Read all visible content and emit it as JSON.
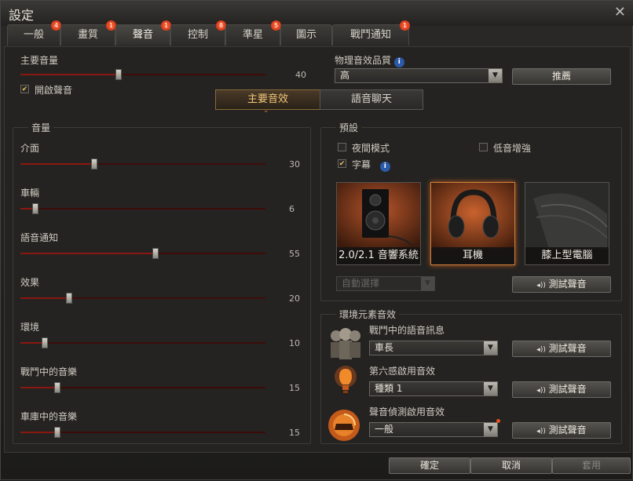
{
  "window": {
    "title": "設定",
    "close_glyph": "✕"
  },
  "tabs": [
    {
      "label": "一般",
      "badge": "4"
    },
    {
      "label": "畫質",
      "badge": "1"
    },
    {
      "label": "聲音",
      "badge": "1"
    },
    {
      "label": "控制",
      "badge": "8"
    },
    {
      "label": "準星",
      "badge": "5"
    },
    {
      "label": "圖示",
      "badge": ""
    },
    {
      "label": "戰鬥通知",
      "badge": "1"
    }
  ],
  "master": {
    "label": "主要音量",
    "value": "40",
    "level": 40,
    "enable_label": "開啟聲音",
    "enabled": true
  },
  "physics": {
    "label": "物理音效品質",
    "info_glyph": "i",
    "selected": "高",
    "recommend_label": "推薦"
  },
  "subtabs": [
    {
      "label": "主要音效"
    },
    {
      "label": "語音聊天"
    }
  ],
  "volume": {
    "group_title": "音量",
    "sliders": [
      {
        "label": "介面",
        "value": "30",
        "level": 30
      },
      {
        "label": "車輛",
        "value": "6",
        "level": 6
      },
      {
        "label": "語音通知",
        "value": "55",
        "level": 55
      },
      {
        "label": "效果",
        "value": "20",
        "level": 20
      },
      {
        "label": "環境",
        "value": "10",
        "level": 10
      },
      {
        "label": "戰鬥中的音樂",
        "value": "15",
        "level": 15
      },
      {
        "label": "車庫中的音樂",
        "value": "15",
        "level": 15
      }
    ]
  },
  "presets": {
    "group_title": "預設",
    "night_mode_label": "夜間模式",
    "night_mode": false,
    "bass_label": "低音增強",
    "bass": false,
    "subtitles_label": "字幕",
    "subtitles": true,
    "info_glyph": "i",
    "cards": [
      {
        "label": "2.0/2.1 音響系統",
        "icon": "speaker-icon",
        "selected": false
      },
      {
        "label": "耳機",
        "icon": "headphones-icon",
        "selected": true
      },
      {
        "label": "膝上型電腦",
        "icon": "laptop-icon",
        "selected": false
      }
    ],
    "auto_select": "自動選擇",
    "test_label": "測試聲音",
    "test_glyph": "◂))"
  },
  "env": {
    "group_title": "環境元素音效",
    "items": [
      {
        "label": "戰鬥中的語音訊息",
        "selected": "車長",
        "icon": "crew-icon"
      },
      {
        "label": "第六感啟用音效",
        "selected": "種類 1",
        "icon": "sixth-sense-bulb-icon"
      },
      {
        "label": "聲音偵測啟用音效",
        "selected": "一般",
        "icon": "sound-detection-icon"
      }
    ],
    "test_label": "測試聲音",
    "test_glyph": "◂))"
  },
  "footer": {
    "ok": "確定",
    "cancel": "取消",
    "apply": "套用"
  },
  "colors": {
    "accent": "#c4240c",
    "slider_fill": "#8a1710",
    "selected_card": "#d08040"
  }
}
